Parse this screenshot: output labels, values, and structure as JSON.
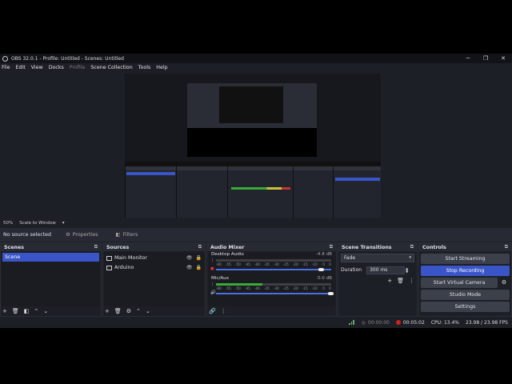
{
  "window": {
    "title": "OBS 32.0.1 - Profile: Untitled - Scenes: Untitled",
    "controls": [
      "─",
      "❐",
      "✕"
    ]
  },
  "menu": [
    "File",
    "Edit",
    "View",
    "Docks",
    "Profile",
    "Scene Collection",
    "Tools",
    "Help"
  ],
  "zoom": {
    "level": "50%",
    "mode": "Scale to Window"
  },
  "source_toolbar": {
    "status": "No source selected",
    "properties": "Properties",
    "filters": "Filters"
  },
  "scenes": {
    "title": "Scenes",
    "items": [
      "Scene"
    ]
  },
  "sources": {
    "title": "Sources",
    "items": [
      "Main Monitor",
      "Arduino"
    ]
  },
  "mixer": {
    "title": "Audio Mixer",
    "channels": [
      {
        "name": "Desktop Audio",
        "db": "-4.8 dB",
        "level": 0.0,
        "volume": 0.92,
        "muted": true
      },
      {
        "name": "Mic/Aux",
        "db": "0.0 dB",
        "level": 0.4,
        "volume": 1.0,
        "muted": false
      }
    ],
    "ticks": [
      "-60",
      "-55",
      "-50",
      "-45",
      "-40",
      "-35",
      "-30",
      "-25",
      "-20",
      "-15",
      "-10",
      "-5",
      "0"
    ]
  },
  "transitions": {
    "title": "Scene Transitions",
    "selected": "Fade",
    "duration_label": "Duration",
    "duration_value": "300 ms"
  },
  "controls": {
    "title": "Controls",
    "buttons": [
      "Start Streaming",
      "Stop Recording",
      "Start Virtual Camera",
      "Studio Mode",
      "Settings"
    ],
    "active": "Stop Recording"
  },
  "status": {
    "stream_time": "00:00:00",
    "rec_time": "00:05:02",
    "cpu": "CPU: 13.4%",
    "fps": "23.98 / 23.98 FPS"
  },
  "colors": {
    "accent": "#3a55c8",
    "record": "#d02020"
  }
}
